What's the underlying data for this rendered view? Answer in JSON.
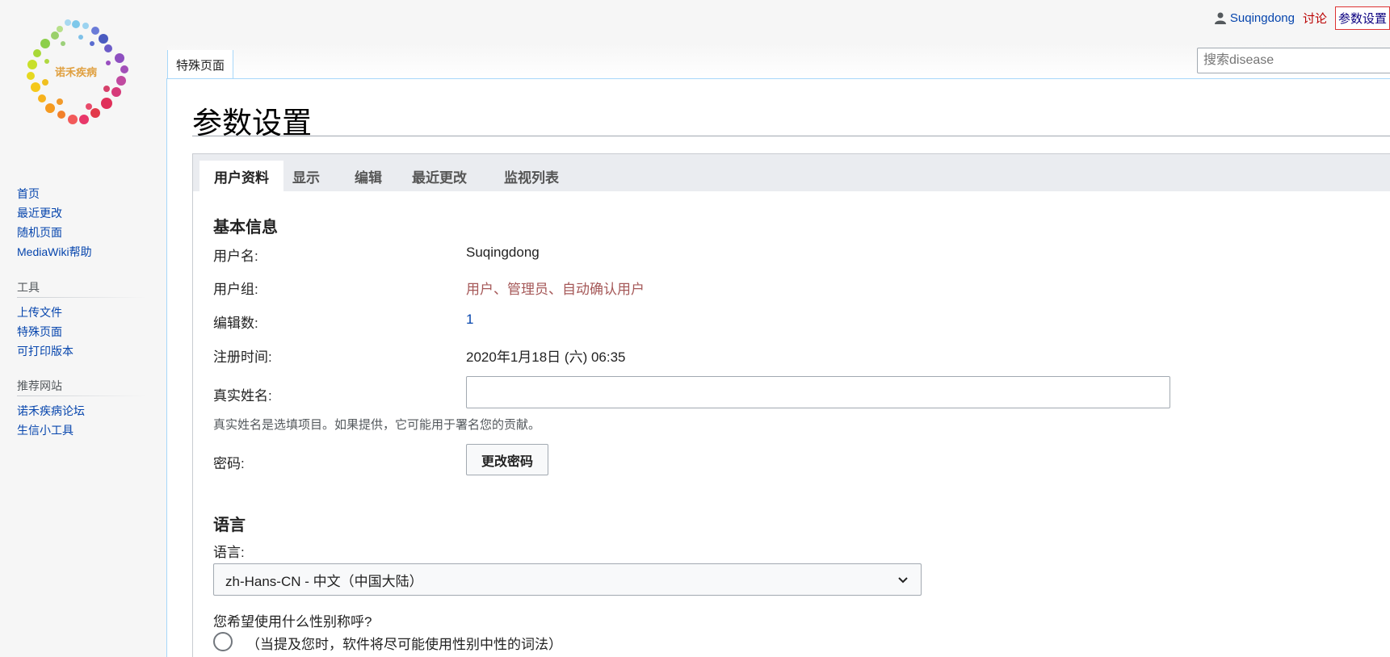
{
  "personal": {
    "username": "Suqingdong",
    "talk": "讨论",
    "preferences": "参数设置"
  },
  "namespace_tab": "特殊页面",
  "search": {
    "placeholder": "搜索disease"
  },
  "logo": {
    "text": "诺禾疾病"
  },
  "page_title": "参数设置",
  "pref_tabs": [
    "用户资料",
    "显示",
    "编辑",
    "最近更改",
    "监视列表"
  ],
  "basic_info": {
    "heading": "基本信息",
    "username_label": "用户名:",
    "username_value": "Suqingdong",
    "groups_label": "用户组:",
    "groups_value": "用户、管理员、自动确认用户",
    "edits_label": "编辑数:",
    "edits_value": "1",
    "registered_label": "注册时间:",
    "registered_value": "2020年1月18日 (六) 06:35",
    "realname_label": "真实姓名:",
    "realname_value": "",
    "realname_help": "真实姓名是选填项目。如果提供，它可能用于署名您的贡献。",
    "password_label": "密码:",
    "change_password": "更改密码"
  },
  "language": {
    "heading": "语言",
    "label": "语言:",
    "selected": "zh-Hans-CN - 中文（中国大陆）",
    "gender_question": "您希望使用什么性别称呼?",
    "gender_neutral": "（当提及您时，软件将尽可能使用性别中性的词法）"
  },
  "sidebar": {
    "nav": [
      "首页",
      "最近更改",
      "随机页面",
      "MediaWiki帮助"
    ],
    "tools_heading": "工具",
    "tools": [
      "上传文件",
      "特殊页面",
      "可打印版本"
    ],
    "sites_heading": "推荐网站",
    "sites": [
      "诺禾疾病论坛",
      "生信小工具"
    ]
  },
  "colors": {
    "link": "#0645ad",
    "groups": "#a55858",
    "talk": "#ba0000",
    "border": "#a7d7f9"
  }
}
